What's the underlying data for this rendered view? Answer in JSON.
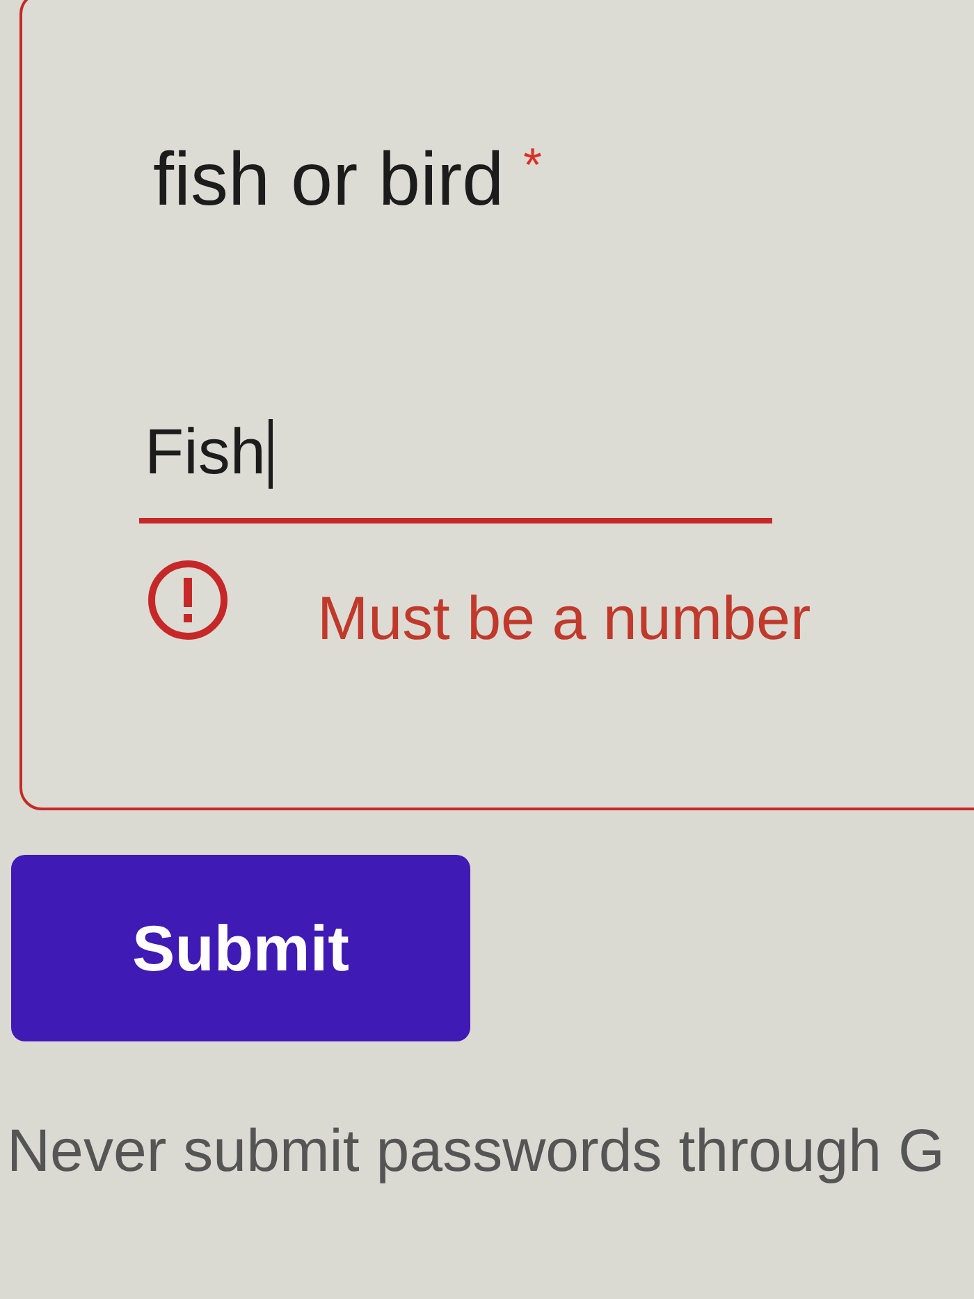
{
  "question": {
    "title": "fish or bird",
    "required_mark": "*",
    "answer": "Fish",
    "focused": true,
    "invalid": true,
    "error": "Must be a number"
  },
  "submit_button": {
    "label": "Submit"
  },
  "footer": {
    "text": "Never submit passwords through G"
  }
}
